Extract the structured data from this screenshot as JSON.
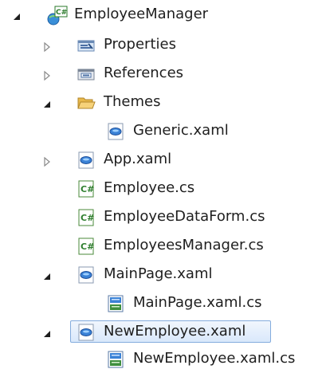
{
  "tree": {
    "nodes": [
      {
        "label": "EmployeeManager",
        "icon": "csharp-project-icon",
        "expander": "expanded"
      },
      {
        "label": "Properties",
        "icon": "properties-folder-icon",
        "expander": "collapsed"
      },
      {
        "label": "References",
        "icon": "references-folder-icon",
        "expander": "collapsed"
      },
      {
        "label": "Themes",
        "icon": "folder-open-icon",
        "expander": "expanded"
      },
      {
        "label": "Generic.xaml",
        "icon": "xaml-file-icon",
        "expander": "none"
      },
      {
        "label": "App.xaml",
        "icon": "xaml-file-icon",
        "expander": "collapsed"
      },
      {
        "label": "Employee.cs",
        "icon": "csharp-file-icon",
        "expander": "none"
      },
      {
        "label": "EmployeeDataForm.cs",
        "icon": "csharp-file-icon",
        "expander": "none"
      },
      {
        "label": "EmployeesManager.cs",
        "icon": "csharp-file-icon",
        "expander": "none"
      },
      {
        "label": "MainPage.xaml",
        "icon": "xaml-file-icon",
        "expander": "expanded"
      },
      {
        "label": "MainPage.xaml.cs",
        "icon": "code-behind-file-icon",
        "expander": "none"
      },
      {
        "label": "NewEmployee.xaml",
        "icon": "xaml-file-icon",
        "expander": "expanded",
        "selected": true
      },
      {
        "label": "NewEmployee.xaml.cs",
        "icon": "code-behind-file-icon",
        "expander": "none"
      }
    ]
  },
  "colors": {
    "selection_border": "#84acdd",
    "selection_fill": "#d9e8fb",
    "text": "#1e1e1e"
  }
}
